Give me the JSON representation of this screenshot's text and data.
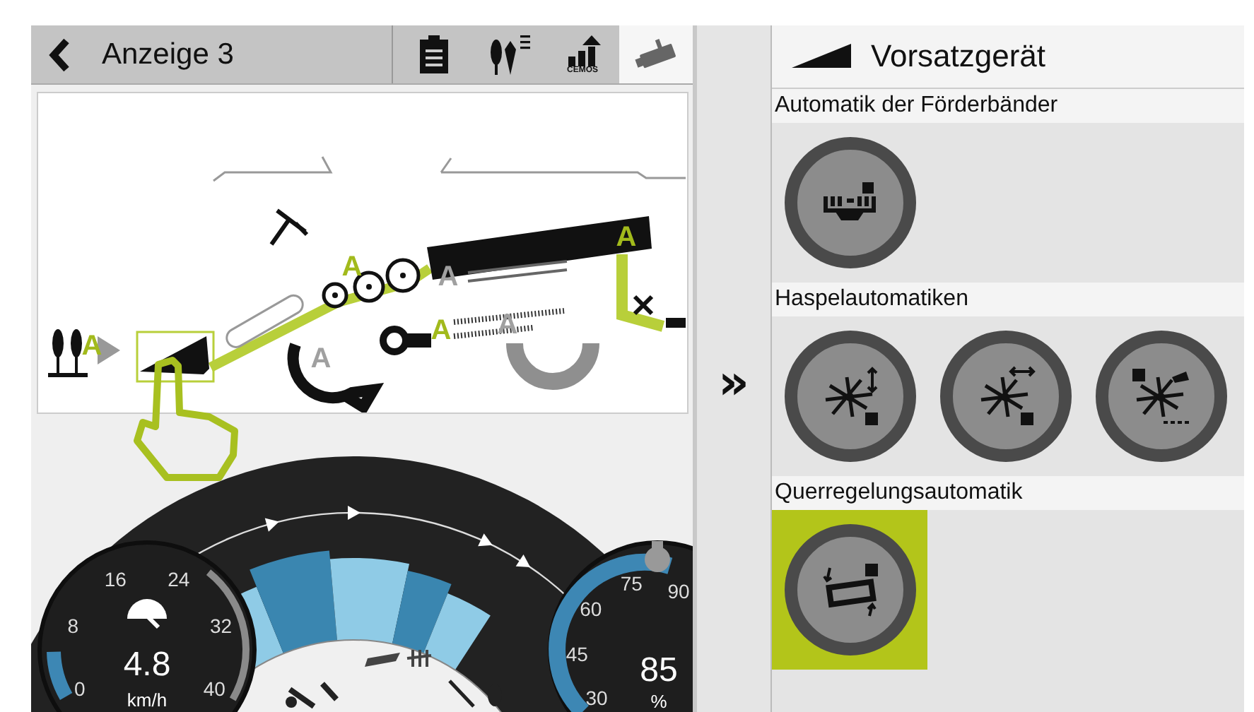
{
  "header": {
    "title": "Anzeige 3",
    "tabs": [
      {
        "kind": "clipboard",
        "selected": false
      },
      {
        "kind": "crop-list",
        "selected": false
      },
      {
        "kind": "cemos",
        "label": "CEMOS",
        "selected": false
      },
      {
        "kind": "camera",
        "selected": true
      }
    ]
  },
  "diagram": {
    "auto_marks": [
      {
        "text": "A",
        "active": true
      },
      {
        "text": "A",
        "active": true
      },
      {
        "text": "A",
        "active": true
      },
      {
        "text": "A",
        "active": false
      },
      {
        "text": "A",
        "active": false
      },
      {
        "text": "A",
        "active": true
      },
      {
        "text": "A",
        "active": false
      }
    ]
  },
  "speed_gauge": {
    "ticks": [
      "0",
      "8",
      "16",
      "24",
      "32",
      "40"
    ],
    "level": 0.12,
    "value": "4.8",
    "unit": "km/h"
  },
  "load_gauge": {
    "ticks": [
      "30",
      "45",
      "60",
      "75",
      "90"
    ],
    "level": 0.92,
    "value": "85",
    "unit": "%"
  },
  "expand_symbol": "»",
  "panel": {
    "title": "Vorsatzgerät",
    "sections": [
      {
        "title": "Automatik der Förderbänder",
        "buttons": [
          {
            "kind": "belt",
            "selected": false
          }
        ]
      },
      {
        "title": "Haspelautomatiken",
        "buttons": [
          {
            "kind": "reel-height",
            "selected": false
          },
          {
            "kind": "reel-position",
            "selected": false
          },
          {
            "kind": "reel-speed",
            "selected": false
          }
        ]
      },
      {
        "title": "Querregelungsautomatik",
        "buttons": [
          {
            "kind": "lateral-tilt",
            "selected": true
          }
        ]
      }
    ]
  }
}
